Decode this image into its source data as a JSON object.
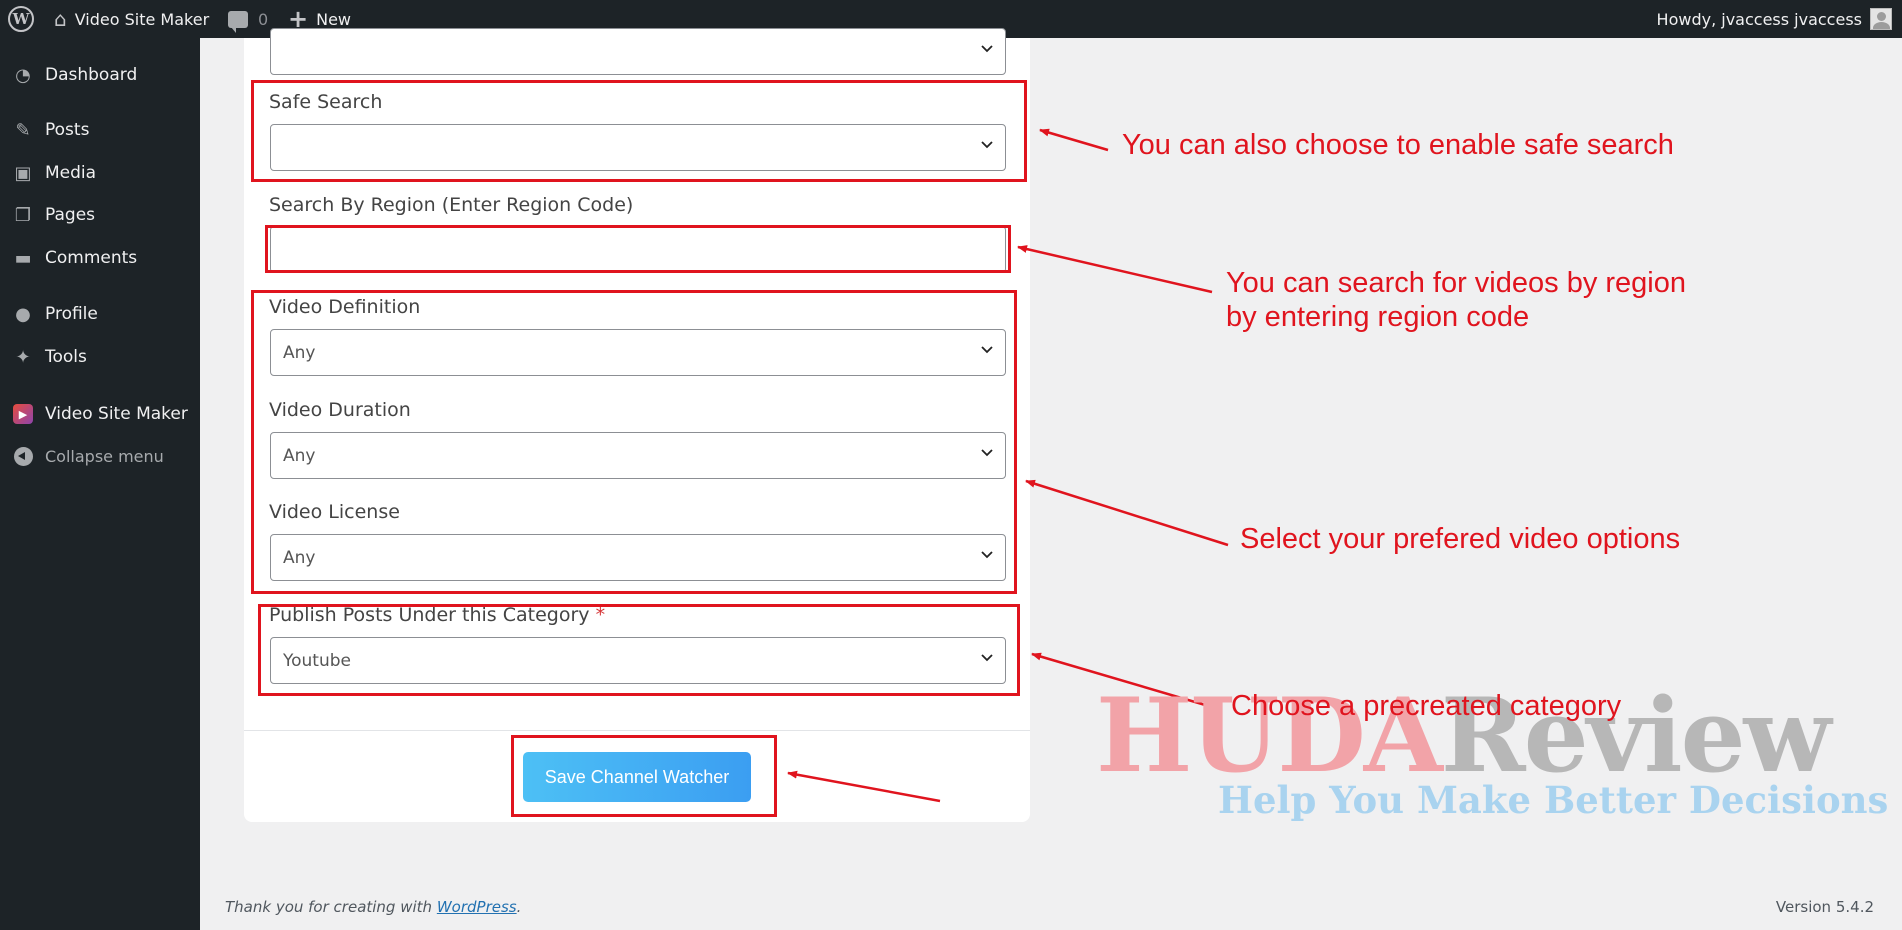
{
  "adminbar": {
    "site_name": "Video Site Maker",
    "comment_count": "0",
    "new_label": "New",
    "howdy": "Howdy, jvaccess jvaccess"
  },
  "sidebar": {
    "items": [
      {
        "label": "Dashboard",
        "icon": "dashboard-icon"
      },
      {
        "label": "Posts",
        "icon": "pin-icon"
      },
      {
        "label": "Media",
        "icon": "media-icon"
      },
      {
        "label": "Pages",
        "icon": "pages-icon"
      },
      {
        "label": "Comments",
        "icon": "comment-icon"
      },
      {
        "label": "Profile",
        "icon": "user-icon"
      },
      {
        "label": "Tools",
        "icon": "wrench-icon"
      },
      {
        "label": "Video Site Maker",
        "icon": "video-site-maker-icon"
      }
    ],
    "collapse": "Collapse menu"
  },
  "form": {
    "safe_search": {
      "label": "Safe Search",
      "value": ""
    },
    "region": {
      "label": "Search By Region (Enter Region Code)",
      "value": ""
    },
    "definition": {
      "label": "Video Definition",
      "value": "Any"
    },
    "duration": {
      "label": "Video Duration",
      "value": "Any"
    },
    "license": {
      "label": "Video License",
      "value": "Any"
    },
    "category": {
      "label": "Publish Posts Under this Category",
      "required_mark": "*",
      "value": "Youtube"
    },
    "save_label": "Save Channel Watcher"
  },
  "annotations": {
    "safe_search": "You can also choose to enable safe search",
    "region_line1": "You can search for videos by region",
    "region_line2": "by entering region code",
    "video_options": "Select your prefered video options",
    "category": "Choose a precreated category",
    "color": "#e0141e"
  },
  "watermark": {
    "logo_part1": "HUDA",
    "logo_part2": "Review",
    "tagline": "Help You Make Better Decisions"
  },
  "footer": {
    "thanks_prefix": "Thank you for creating with ",
    "wordpress_link": "WordPress",
    "thanks_suffix": ".",
    "version": "Version 5.4.2"
  }
}
